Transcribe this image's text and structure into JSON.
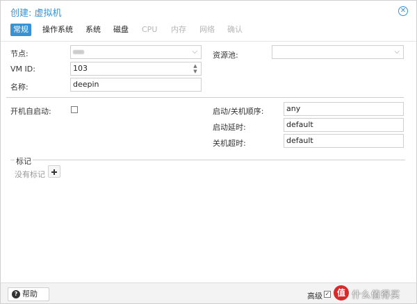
{
  "window": {
    "title": "创建: 虚拟机",
    "close_icon": "close-icon"
  },
  "tabs": [
    {
      "label": "常规",
      "state": "active"
    },
    {
      "label": "操作系统",
      "state": "enabled"
    },
    {
      "label": "系统",
      "state": "enabled"
    },
    {
      "label": "磁盘",
      "state": "enabled"
    },
    {
      "label": "CPU",
      "state": "disabled"
    },
    {
      "label": "内存",
      "state": "disabled"
    },
    {
      "label": "网络",
      "state": "disabled"
    },
    {
      "label": "确认",
      "state": "disabled"
    }
  ],
  "form": {
    "node_label": "节点:",
    "node_value": "",
    "vmid_label": "VM ID:",
    "vmid_value": "103",
    "name_label": "名称:",
    "name_value": "deepin",
    "pool_label": "资源池:",
    "pool_value": "",
    "onboot_label": "开机自启动:",
    "onboot_checked": false,
    "startup_order_label": "启动/关机顺序:",
    "startup_order_value": "any",
    "startup_delay_label": "启动延时:",
    "startup_delay_value": "default",
    "shutdown_timeout_label": "关机超时:",
    "shutdown_timeout_value": "default"
  },
  "tags": {
    "legend": "标记",
    "empty_text": "没有标记",
    "add_icon": "plus-icon"
  },
  "footer": {
    "help_label": "帮助",
    "help_icon": "question-icon",
    "advanced_label": "高级",
    "advanced_checked": true
  },
  "watermark": {
    "badge": "值",
    "text": "什么值得买"
  },
  "colors": {
    "accent": "#3892d4",
    "disabled_text": "#b5b5b5",
    "footer_bg": "#f3f3f3"
  }
}
